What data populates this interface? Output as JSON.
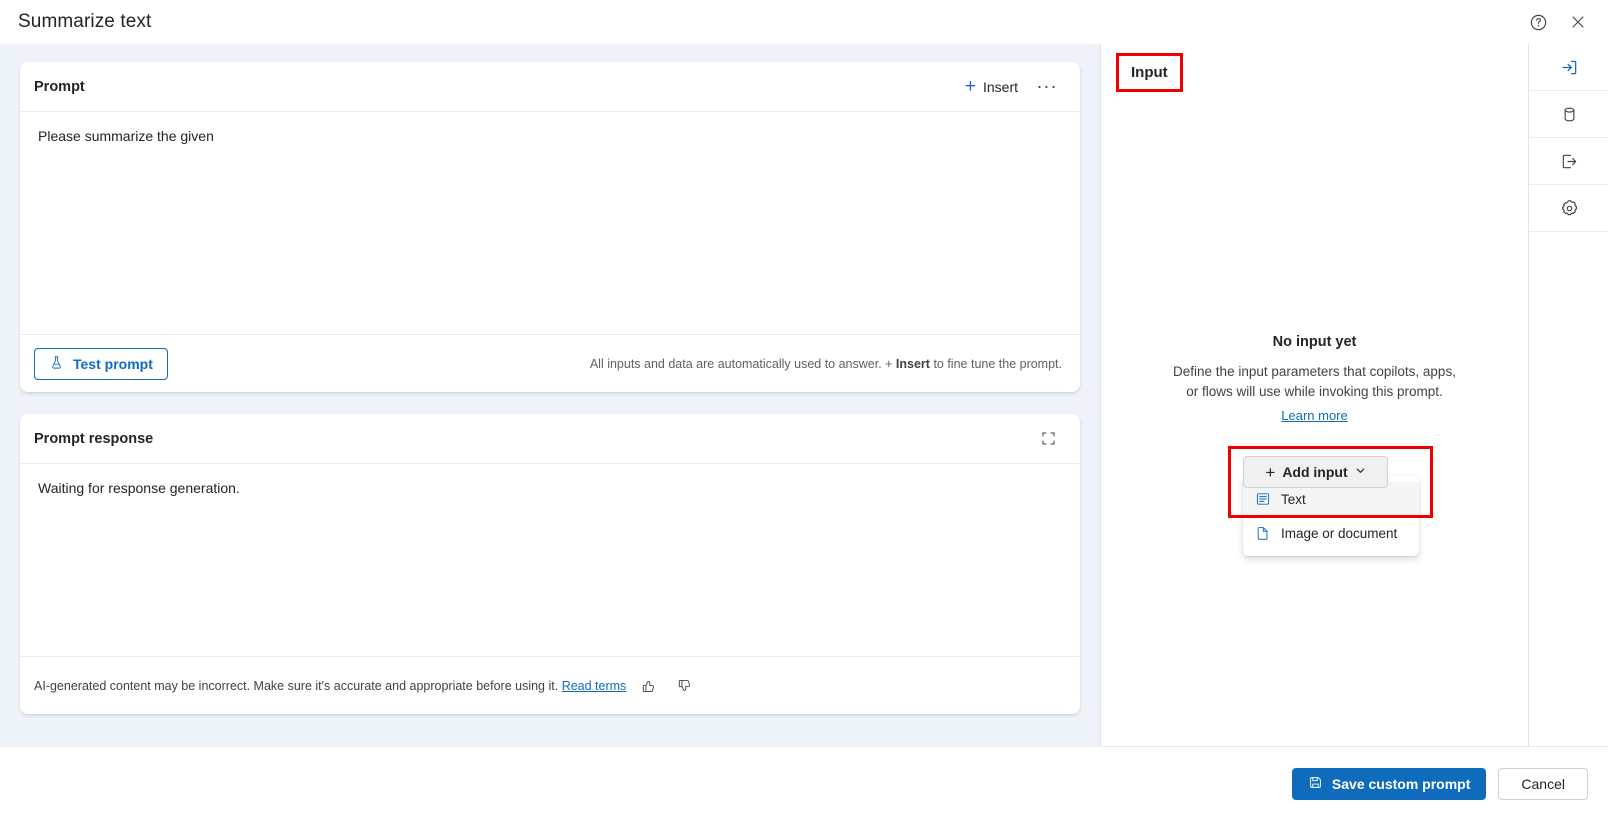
{
  "window": {
    "title": "Summarize text",
    "help_icon": "question-circle-icon",
    "close_icon": "close-icon"
  },
  "prompt_card": {
    "title": "Prompt",
    "insert_label": "Insert",
    "more_label": "···",
    "body_text": "Please summarize the given",
    "test_button_label": "Test prompt",
    "hint_prefix": "All inputs and data are automatically used to answer. + ",
    "hint_bold": "Insert",
    "hint_suffix": " to fine tune the prompt."
  },
  "response_card": {
    "title": "Prompt response",
    "body_text": "Waiting for response generation.",
    "disclaimer_text": "AI-generated content may be incorrect. Make sure it's accurate and appropriate before using it.",
    "disclaimer_link": "Read terms",
    "thumbs_up_icon": "thumbs-up-icon",
    "thumbs_down_icon": "thumbs-down-icon"
  },
  "input_panel": {
    "label": "Input",
    "empty_title": "No input yet",
    "empty_desc_line1": "Define the input parameters that copilots, apps,",
    "empty_desc_line2": "or flows will use while invoking this prompt.",
    "learn_more": "Learn more",
    "add_input_label": "Add input",
    "menu": [
      {
        "label": "Text",
        "icon": "text-lines-icon",
        "highlighted": true
      },
      {
        "label": "Image or document",
        "icon": "document-icon",
        "highlighted": false
      }
    ]
  },
  "rail": [
    {
      "name": "input-icon",
      "active": true
    },
    {
      "name": "database-icon",
      "active": false
    },
    {
      "name": "output-icon",
      "active": false
    },
    {
      "name": "settings-gear-icon",
      "active": false
    }
  ],
  "footer": {
    "save_label": "Save custom prompt",
    "cancel_label": "Cancel"
  },
  "colors": {
    "accent": "#0f6cbd",
    "annotation": "#ee0000",
    "canvas": "#eef3fa"
  }
}
